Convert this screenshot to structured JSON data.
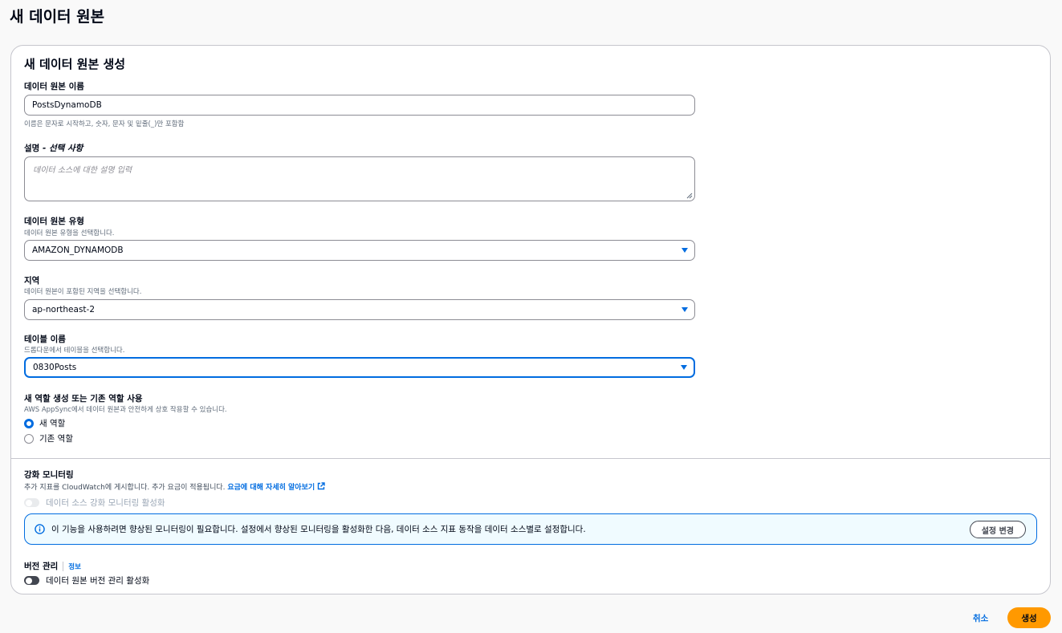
{
  "page": {
    "title": "새 데이터 원본"
  },
  "card": {
    "title": "새 데이터 원본 생성"
  },
  "name_field": {
    "label": "데이터 원본 이름",
    "value": "PostsDynamoDB",
    "hint": "이름은 문자로 시작하고, 숫자, 문자 및 밑줄(_)만 포함함"
  },
  "description_field": {
    "label": "설명",
    "label_optional": "- 선택 사항",
    "placeholder": "데이터 소스에 대한 설명 입력"
  },
  "type_field": {
    "label": "데이터 원본 유형",
    "hint": "데이터 원본 유형을 선택합니다.",
    "value": "AMAZON_DYNAMODB"
  },
  "region_field": {
    "label": "지역",
    "hint": "데이터 원본이 포함된 지역을 선택합니다.",
    "value": "ap-northeast-2"
  },
  "table_field": {
    "label": "테이블 이름",
    "hint": "드롭다운에서 테이블을 선택합니다.",
    "value": "0830Posts"
  },
  "role_field": {
    "label": "새 역할 생성 또는 기존 역할 사용",
    "hint": "AWS AppSync에서 데이터 원본과 안전하게 상호 작용할 수 있습니다.",
    "options": [
      {
        "label": "새 역할",
        "checked": true
      },
      {
        "label": "기존 역할",
        "checked": false
      }
    ]
  },
  "monitoring": {
    "label": "강화 모니터링",
    "hint": "추가 지표를 CloudWatch에 게시합니다. 추가 요금이 적용됩니다.",
    "link": "요금에 대해 자세히 알아보기",
    "toggle_label": "데이터 소스 강화 모니터링 활성화",
    "alert_text": "이 기능을 사용하려면 향상된 모니터링이 필요합니다. 설정에서 향상된 모니터링을 활성화한 다음, 데이터 소스 지표 동작을 데이터 소스별로 설정합니다.",
    "alert_button": "설정 변경"
  },
  "versioning": {
    "label": "버전 관리",
    "info": "정보",
    "toggle_label": "데이터 원본 버전 관리 활성화"
  },
  "footer": {
    "cancel": "취소",
    "create": "생성"
  },
  "colors": {
    "accent": "#006ce0",
    "primary_button": "#ff9900",
    "alert_bg": "#f0fbff"
  }
}
